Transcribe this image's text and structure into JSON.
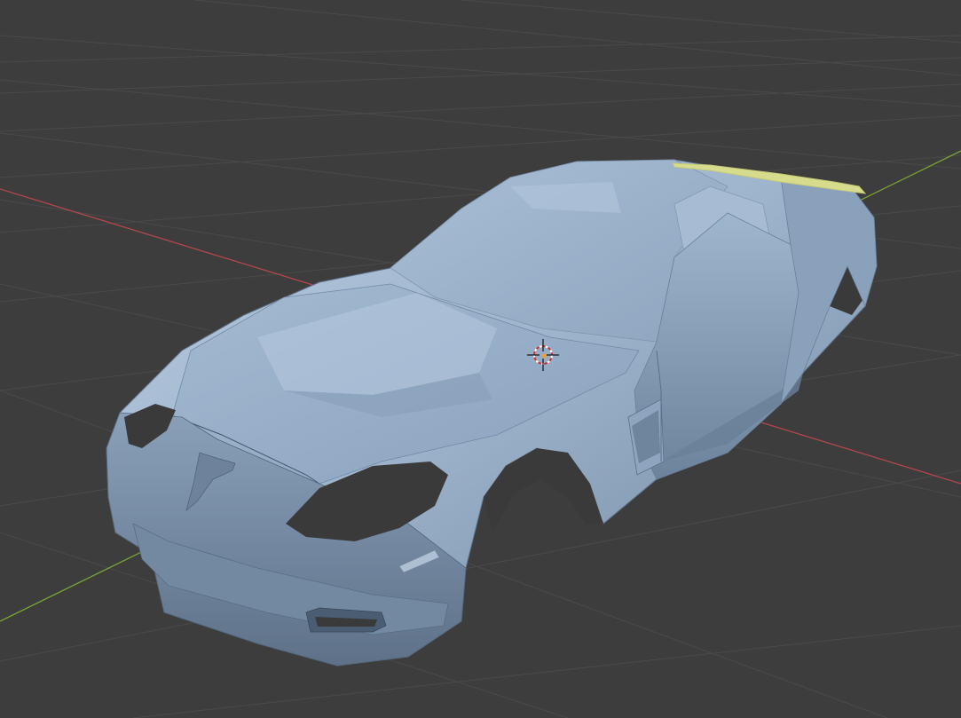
{
  "viewport": {
    "label": "",
    "background": "#3d3d3d",
    "grid_color": "#4a4a4a",
    "x_axis_color": "#b3474e",
    "y_axis_color": "#7aa236",
    "mesh_color": "#9bb1c9",
    "selected_part_color": "#d6dc8c",
    "objects": [
      "car-body-mesh",
      "rear-spoiler",
      "3d-cursor"
    ]
  }
}
